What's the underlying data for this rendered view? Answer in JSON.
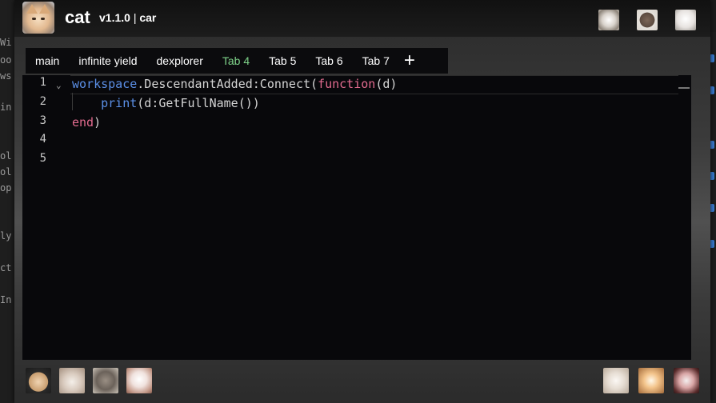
{
  "background": {
    "left_fragments": [
      "Wi",
      "oo",
      "ws",
      "in",
      "ol",
      "ol",
      "op",
      "ly",
      "ct",
      "In"
    ],
    "right_marks": [
      "#3b7fd6",
      "#3b7fd6",
      "#3b7fd6",
      "#3b7fd6",
      "#3b7fd6",
      "#3b7fd6"
    ]
  },
  "window": {
    "app_name": "cat",
    "version": "v1.1.0",
    "separator": "|",
    "subtitle": "car"
  },
  "tabs": [
    {
      "label": "main",
      "active": false
    },
    {
      "label": "infinite yield",
      "active": false
    },
    {
      "label": "dexplorer",
      "active": false
    },
    {
      "label": "Tab 4",
      "active": true
    },
    {
      "label": "Tab 5",
      "active": false
    },
    {
      "label": "Tab 6",
      "active": false
    },
    {
      "label": "Tab 7",
      "active": false
    }
  ],
  "add_tab_label": "+",
  "editor": {
    "line_numbers": [
      "1",
      "2",
      "3",
      "4",
      "5"
    ],
    "fold_glyph": "⌄",
    "code": {
      "l1_workspace": "workspace",
      "l1_dot": ".DescendantAdded:Connect(",
      "l1_function": "function",
      "l1_args": "(d)",
      "l2_indent": "    ",
      "l2_print": "print",
      "l2_rest": "(d:GetFullName())",
      "l3_end": "end",
      "l3_close": ")"
    }
  },
  "top_avatars": [
    "cat-avatar-1",
    "cat-avatar-2",
    "cat-avatar-3"
  ],
  "bottom_left_avatars": [
    "cat-avatar-4",
    "cat-avatar-5",
    "cat-avatar-6",
    "cat-avatar-7"
  ],
  "bottom_right_avatars": [
    "cat-avatar-8",
    "cat-avatar-9",
    "cat-avatar-10"
  ]
}
